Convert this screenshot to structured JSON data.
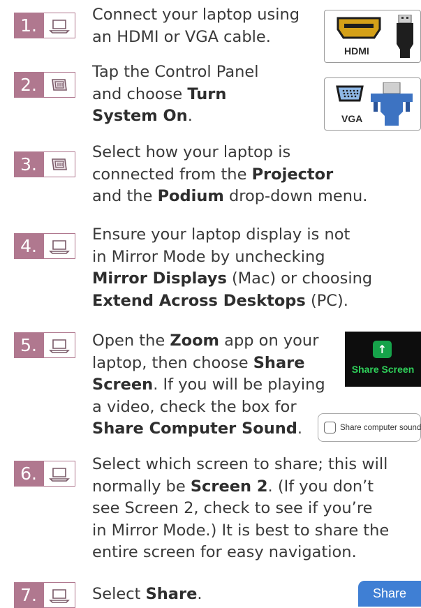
{
  "colors": {
    "badge": "#b0788f",
    "text": "#3a3a3a",
    "zoom_green": "#16a34a",
    "zoom_text": "#2fd15a",
    "share_blue": "#3f7fd4"
  },
  "steps": [
    {
      "number": "1.",
      "icon": "laptop-icon",
      "lines": [
        [
          {
            "t": "Connect your laptop using"
          }
        ],
        [
          {
            "t": "an HDMI or VGA cable."
          }
        ]
      ]
    },
    {
      "number": "2.",
      "icon": "control-panel-icon",
      "lines": [
        [
          {
            "t": "Tap the Control Panel"
          }
        ],
        [
          {
            "t": "and choose "
          },
          {
            "t": "Turn",
            "b": true
          }
        ],
        [
          {
            "t": "System On",
            "b": true
          },
          {
            "t": "."
          }
        ]
      ]
    },
    {
      "number": "3.",
      "icon": "control-panel-icon",
      "lines": [
        [
          {
            "t": "Select how your laptop is"
          }
        ],
        [
          {
            "t": "connected from the "
          },
          {
            "t": "Projector",
            "b": true
          }
        ],
        [
          {
            "t": "and the "
          },
          {
            "t": "Podium",
            "b": true
          },
          {
            "t": " drop-down menu."
          }
        ]
      ]
    },
    {
      "number": "4.",
      "icon": "laptop-icon",
      "lines": [
        [
          {
            "t": "Ensure your laptop display is not"
          }
        ],
        [
          {
            "t": "in Mirror Mode by unchecking"
          }
        ],
        [
          {
            "t": "Mirror Displays",
            "b": true
          },
          {
            "t": " (Mac) or choosing"
          }
        ],
        [
          {
            "t": "Extend Across Desktops",
            "b": true
          },
          {
            "t": " (PC)."
          }
        ]
      ]
    },
    {
      "number": "5.",
      "icon": "laptop-icon",
      "lines": [
        [
          {
            "t": "Open the "
          },
          {
            "t": "Zoom",
            "b": true
          },
          {
            "t": " app on your"
          }
        ],
        [
          {
            "t": "laptop, then choose "
          },
          {
            "t": "Share",
            "b": true
          }
        ],
        [
          {
            "t": "Screen",
            "b": true
          },
          {
            "t": ". If you will be playing"
          }
        ],
        [
          {
            "t": "a video, check the box for"
          }
        ],
        [
          {
            "t": "Share Computer Sound",
            "b": true
          },
          {
            "t": "."
          }
        ]
      ]
    },
    {
      "number": "6.",
      "icon": "laptop-icon",
      "lines": [
        [
          {
            "t": "Select which screen to share; this will"
          }
        ],
        [
          {
            "t": "normally be "
          },
          {
            "t": "Screen 2",
            "b": true
          },
          {
            "t": ". (If you don’t"
          }
        ],
        [
          {
            "t": "see Screen 2, check to see if you’re"
          }
        ],
        [
          {
            "t": "in Mirror Mode.) It is best to share the"
          }
        ],
        [
          {
            "t": "entire screen for easy navigation."
          }
        ]
      ]
    },
    {
      "number": "7.",
      "icon": "laptop-icon",
      "lines": [
        [
          {
            "t": "Select "
          },
          {
            "t": "Share",
            "b": true
          },
          {
            "t": "."
          }
        ]
      ]
    }
  ],
  "connectors": {
    "hdmi_label": "HDMI",
    "vga_label": "VGA"
  },
  "zoom": {
    "arrow_glyph": "↑",
    "share_screen_label": "Share Screen",
    "computer_sound_label": "Share computer sound",
    "computer_sound_checked": false,
    "share_button_label": "Share"
  }
}
